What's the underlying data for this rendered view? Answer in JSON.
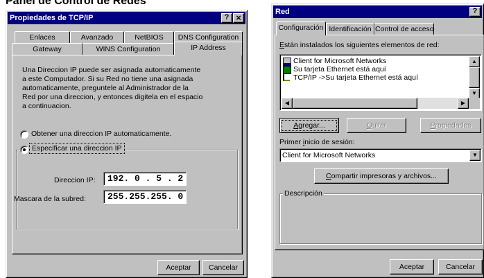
{
  "page_title": "Panel de Control de Redes",
  "tcpip": {
    "title": "Propiedades de TCP/IP",
    "help_btn": "?",
    "close_btn": "×",
    "tabs_row1": [
      "Enlaces",
      "Avanzado",
      "NetBIOS",
      "DNS Configuration"
    ],
    "tabs_row2": [
      "Gateway",
      "WINS Configuration",
      "IP Address"
    ],
    "description": "Una Direccion IP puede ser asignada automaticamente a este Computador. Si su Red no tiene una asignada automaticamente, preguntele al Administrador de la Red por una direccion, y entonces digitela en el espacio a continuacion.",
    "radio_auto": "Obtener una direccion IP automaticamente.",
    "radio_manual": "Especificar una direccion IP",
    "ip_label": "Direccion IP:",
    "ip_value": "192. 0 . 5 . 2",
    "mask_label": "Mascara de la subred:",
    "mask_value": "255.255.255. 0",
    "ok": "Aceptar",
    "cancel": "Cancelar"
  },
  "red": {
    "title": "Red",
    "help_btn": "?",
    "tabs": [
      "Configuración",
      "Identificación",
      "Control de acceso"
    ],
    "installed_label_u": "E",
    "installed_label": "stán instalados los siguientes elementos de red:",
    "components": [
      {
        "label": "Client for Microsoft Networks",
        "icon": "client-icon"
      },
      {
        "label": "Su tarjeta Ethernet está aquí",
        "icon": "adapter-icon"
      },
      {
        "label": "TCP/IP ->Su tarjeta Ethernet está aquí",
        "icon": "protocol-icon"
      }
    ],
    "add_u": "A",
    "add": "gregar...",
    "remove_u": "Q",
    "remove": "uitar",
    "props_u": "P",
    "props": "ropiedades",
    "logon_pre": "Primer ",
    "logon_u": "i",
    "logon_post": "nicio de sesión:",
    "logon_value": "Client for Microsoft Networks",
    "share_u": "C",
    "share": "ompartir impresoras y archivos...",
    "desc_label": "Descripción",
    "ok": "Aceptar",
    "cancel": "Cancelar"
  }
}
